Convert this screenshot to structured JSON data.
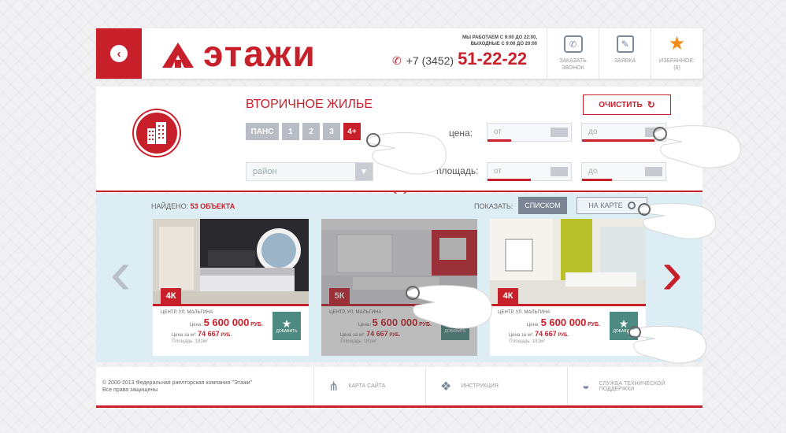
{
  "header": {
    "logo_text": "этажи",
    "hours_line1": "МЫ РАБОТАЕМ С 9:00 ДО 22:00,",
    "hours_line2": "ВЫХОДНЫЕ С 9:00 ДО 20:00",
    "phone_prefix": "+7 (3452)",
    "phone_number": "51-22-22",
    "order_call_line1": "ЗАКАЗАТЬ",
    "order_call_line2": "ЗВОНОК",
    "request_label": "ЗАЯВКА",
    "favorites_line1": "ИЗБРАННОЕ:",
    "favorites_line2": "(8)"
  },
  "filters": {
    "title": "ВТОРИЧНОЕ ЖИЛЬЕ",
    "rooms": [
      "ПАНС",
      "1",
      "2",
      "3",
      "4+"
    ],
    "district_placeholder": "район",
    "price_label": "цена:",
    "area_label": "площадь:",
    "from": "от",
    "to": "до",
    "clear_label": "ОЧИСТИТЬ"
  },
  "results": {
    "found_label": "НАЙДЕНО:",
    "found_value": "53 ОБЪЕКТА",
    "show_label": "ПОКАЗАТЬ:",
    "list_label": "СПИСКОМ",
    "map_label": "НА КАРТЕ",
    "cards": [
      {
        "rooms": "4К",
        "address": "ЦЕНТР, УЛ. МАЛЬГИНА",
        "price_label": "Цена:",
        "price": "5 600 000",
        "currency": "РУБ.",
        "sqm_label": "Цена за м²:",
        "sqm_price": "74 667",
        "sqm_currency": "РУБ.",
        "area_label": "Площадь:",
        "area": "181м²",
        "add_label": "ДОБАВИТЬ"
      },
      {
        "rooms": "5К",
        "address": "ЦЕНТР, УЛ. МАЛЬГИНА",
        "price_label": "Цена:",
        "price": "5 600 000",
        "currency": "РУБ.",
        "sqm_label": "Цена за м²:",
        "sqm_price": "74 667",
        "sqm_currency": "РУБ.",
        "area_label": "Площадь:",
        "area": "181м²",
        "add_label": "ДОБАВИТЬ"
      },
      {
        "rooms": "4К",
        "address": "ЦЕНТР, УЛ. МАЛЬГИНА",
        "price_label": "Цена:",
        "price": "5 600 000",
        "currency": "РУБ.",
        "sqm_label": "Цена за м²:",
        "sqm_price": "74 667",
        "sqm_currency": "РУБ.",
        "area_label": "Площадь:",
        "area": "181м²",
        "add_label": "ДОБАВИТЬ"
      }
    ]
  },
  "footer": {
    "copyright_line1": "© 2000-2013 Федеральная риелторская компания \"Этажи\"",
    "copyright_line2": "Все права защищены",
    "sitemap": "КАРТА САЙТА",
    "instructions": "ИНСТРУКЦИЯ",
    "support_line1": "СЛУЖБА ТЕХНИЧЕСКОЙ",
    "support_line2": "ПОДДЕРЖКИ"
  },
  "colors": {
    "accent": "#c8202b",
    "panel": "#dceef4",
    "add_button": "#4c8a82"
  }
}
